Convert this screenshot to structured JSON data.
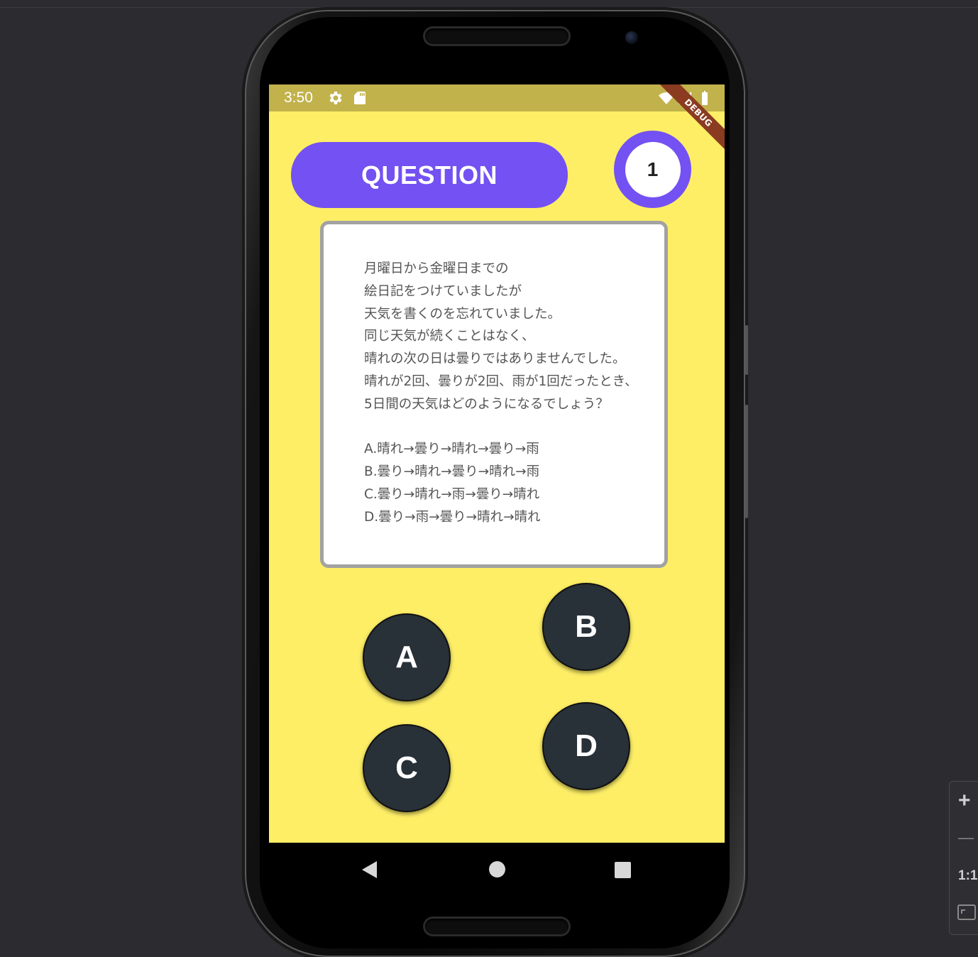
{
  "status_bar": {
    "time": "3:50",
    "left_icons": [
      "gear-icon",
      "sd-card-icon"
    ],
    "right_icons": [
      "wifi-icon",
      "battery-icon"
    ]
  },
  "debug_banner": "DEBUG",
  "header": {
    "title": "QUESTION",
    "question_number": "1"
  },
  "question": {
    "lines": [
      "月曜日から金曜日までの",
      "絵日記をつけていましたが",
      "天気を書くのを忘れていました。",
      "同じ天気が続くことはなく、",
      "晴れの次の日は曇りではありませんでした。",
      "晴れが2回、曇りが2回、雨が1回だったとき、",
      "5日間の天気はどのようになるでしょう？",
      "",
      "A.晴れ→曇り→晴れ→曇り→雨",
      "B.曇り→晴れ→曇り→晴れ→雨",
      "C.曇り→晴れ→雨→曇り→晴れ",
      "D.曇り→雨→曇り→晴れ→晴れ"
    ]
  },
  "answers": {
    "a": "A",
    "b": "B",
    "c": "C",
    "d": "D"
  },
  "nav_bar": [
    "back-icon",
    "home-icon",
    "recents-icon"
  ],
  "zoom_controls": {
    "plus": "+",
    "minus": "—",
    "one_to_one": "1:1"
  },
  "colors": {
    "screen_bg": "#fdee66",
    "status_bar": "#c1b24c",
    "accent_purple": "#7351f2",
    "answer_button": "#283038"
  }
}
